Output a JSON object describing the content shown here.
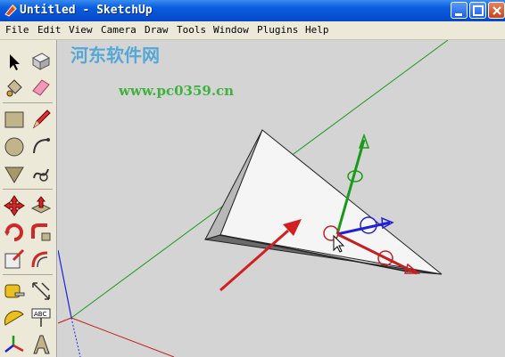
{
  "window": {
    "title": "Untitled - SketchUp",
    "buttons": [
      "minimize",
      "maximize",
      "close"
    ]
  },
  "menubar": {
    "items": [
      "File",
      "Edit",
      "View",
      "Camera",
      "Draw",
      "Tools",
      "Window",
      "Plugins",
      "Help"
    ]
  },
  "toolbar": {
    "tools": [
      "select-arrow-icon",
      "eraser-icon",
      "paint-bucket-icon",
      "eraser-pink-icon",
      "rectangle-icon",
      "pencil-icon",
      "circle-icon",
      "arc-icon",
      "polygon-icon",
      "freehand-icon",
      "move-icon",
      "push-pull-icon",
      "rotate-icon",
      "follow-me-icon",
      "scale-icon",
      "offset-icon",
      "tape-measure-icon",
      "dimension-icon",
      "protractor-icon",
      "text-label-icon",
      "axes-icon",
      "3d-text-icon"
    ]
  },
  "watermark": {
    "url": "www.pc0359.cn",
    "brand": "河东软件网"
  },
  "colors": {
    "titlebar": "#0a5ee0",
    "menubar": "#ece9d8",
    "viewport": "#d4d4d4",
    "model_face": "#f5f5f5",
    "axis_red": "#c42020",
    "axis_green": "#1a9a1a",
    "axis_blue": "#2020d8",
    "arrow": "#d02020",
    "watermark": "#2fae2f"
  }
}
